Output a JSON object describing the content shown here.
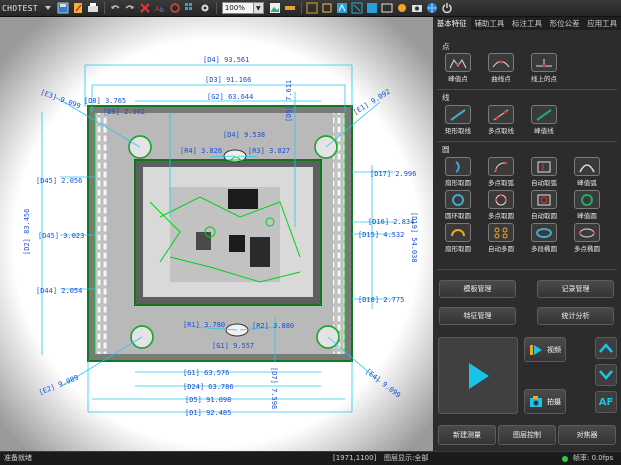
{
  "app": {
    "title": "CHOTEST"
  },
  "toolbar": {
    "zoom_value": "100%",
    "icons": [
      "save-icon",
      "edit-icon",
      "print-icon",
      "undo-icon",
      "redo-icon",
      "close-icon",
      "text-icon",
      "grid-icon",
      "settings-icon",
      "image-icon",
      "ruler-icon",
      "measure-icon",
      "camera-icon",
      "gear-icon",
      "globe-icon",
      "power-icon"
    ]
  },
  "tabs": [
    "基本特征",
    "辅助工具",
    "标注工具",
    "形位公差",
    "应用工具"
  ],
  "panel": {
    "point_section": {
      "label": "点",
      "tools": [
        "峰值点",
        "曲线点",
        "线上的点"
      ]
    },
    "line_section": {
      "label": "线",
      "tools": [
        "矩形取线",
        "多点取线",
        "峰值线"
      ]
    },
    "circle_section": {
      "label": "圆",
      "tools": [
        "扇形取圆",
        "多点取弧",
        "自动取弧",
        "峰值弧",
        "圆环取圆",
        "多点取圆",
        "自动取圆",
        "峰值圆",
        "扇形取圆",
        "自动多圆",
        "多段椭圆",
        "多点椭圆"
      ]
    },
    "buttons": {
      "template_mgmt": "模板管理",
      "record_mgmt": "记录管理",
      "feature_mgmt": "特征管理",
      "stats": "统计分析",
      "video": "视频",
      "capture": "拍摄",
      "af": "AF",
      "new_measure": "新建测量",
      "layer_ctrl": "图层控制",
      "focus": "对焦器"
    }
  },
  "canvas": {
    "labels": [
      "[D4] 93.561",
      "[D3] 91.166",
      "[G2] 63.644",
      "[E3] 9.099",
      "[D8] 3.765",
      "[D9] 2.502",
      "[E1] 9.092",
      "[D5] 7.611",
      "[D4] 9.538",
      "[R4] 3.826",
      "[R3] 3.827",
      "[D45] 2.056",
      "[D2] 83.456",
      "[D45] 3.023",
      "[D44] 2.054",
      "[D17] 2.996",
      "[D16] 2.834",
      "[D15] 4.532",
      "[D19] 54.038",
      "[D18] 2.775",
      "[R1] 3.780",
      "[R2] 3.880",
      "[G1] 9.557",
      "[G1] 63.576",
      "[D24] 63.786",
      "[D5] 91.098",
      "[D1] 92.485",
      "[E2] 9.089",
      "[E4] 9.099",
      "[D7] 7.598"
    ]
  },
  "status": {
    "left": "准备就绪",
    "coords": "[1971,1100]",
    "layer": "图层显示:全部",
    "fps": "帧率: 0.0fps"
  },
  "colors": {
    "dimension": "#1a4fd6",
    "feature": "#00d11a",
    "accent_cyan": "#20c8f0"
  }
}
